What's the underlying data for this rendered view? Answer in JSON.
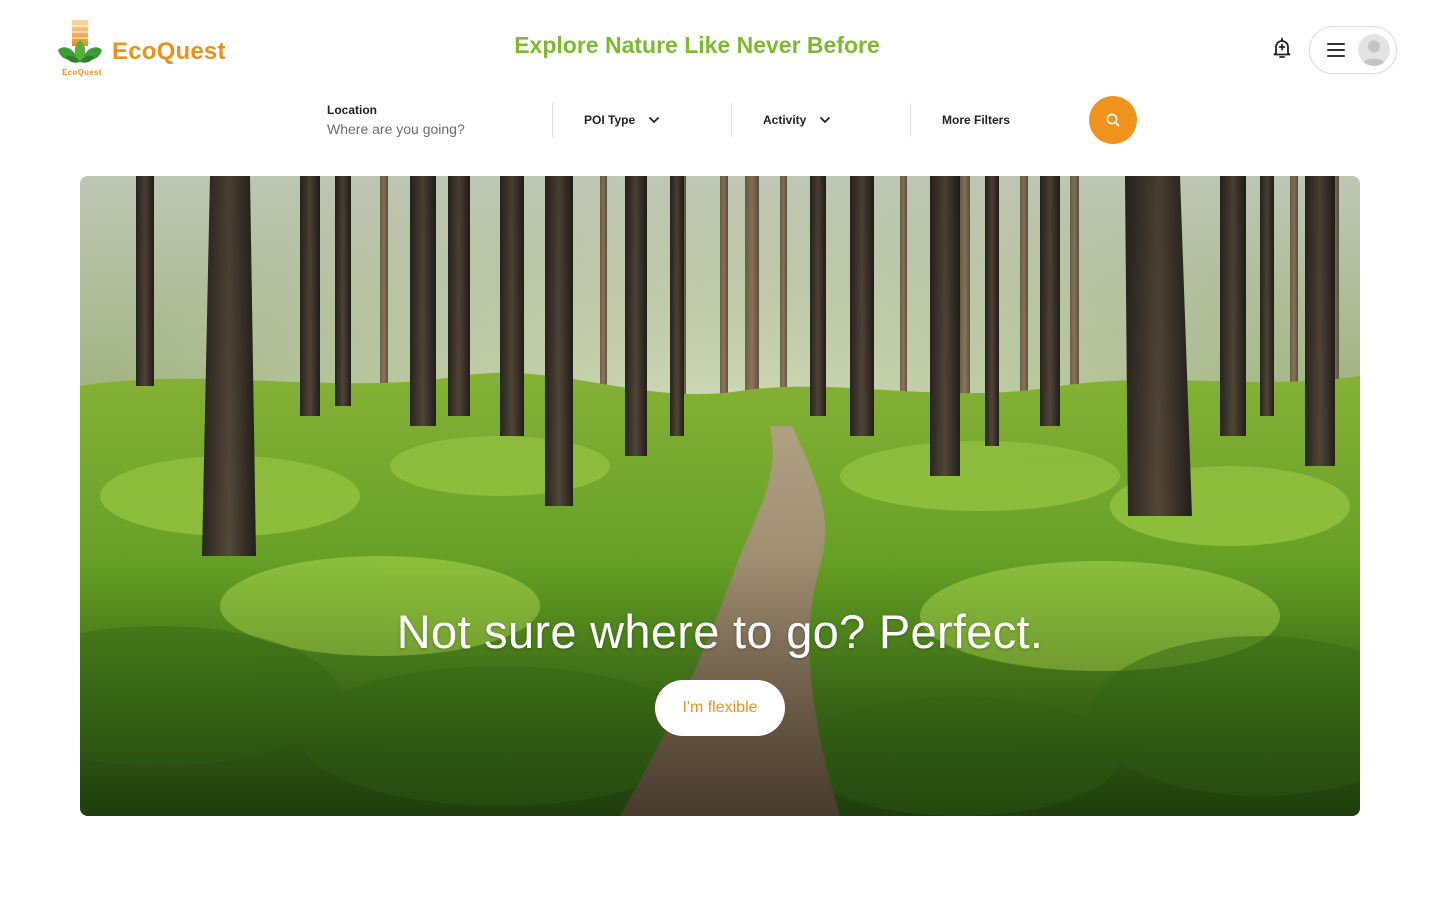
{
  "brand": {
    "name": "EcoQuest",
    "small_label": "EcoQuest",
    "color_primary": "#E8921E",
    "color_green": "#7DBA2F"
  },
  "header": {
    "tagline": "Explore Nature Like Never Before",
    "icons": {
      "notification": "bell-plus-icon",
      "menu": "hamburger-icon",
      "avatar": "user-avatar-icon"
    }
  },
  "search": {
    "location_label": "Location",
    "location_placeholder": "Where are you going?",
    "poi_label": "POI Type",
    "activity_label": "Activity",
    "more_filters_label": "More Filters",
    "button_icon": "search-icon"
  },
  "hero": {
    "title": "Not sure where to go? Perfect.",
    "button_label": "I'm flexible",
    "image": "forest-path-photo"
  }
}
